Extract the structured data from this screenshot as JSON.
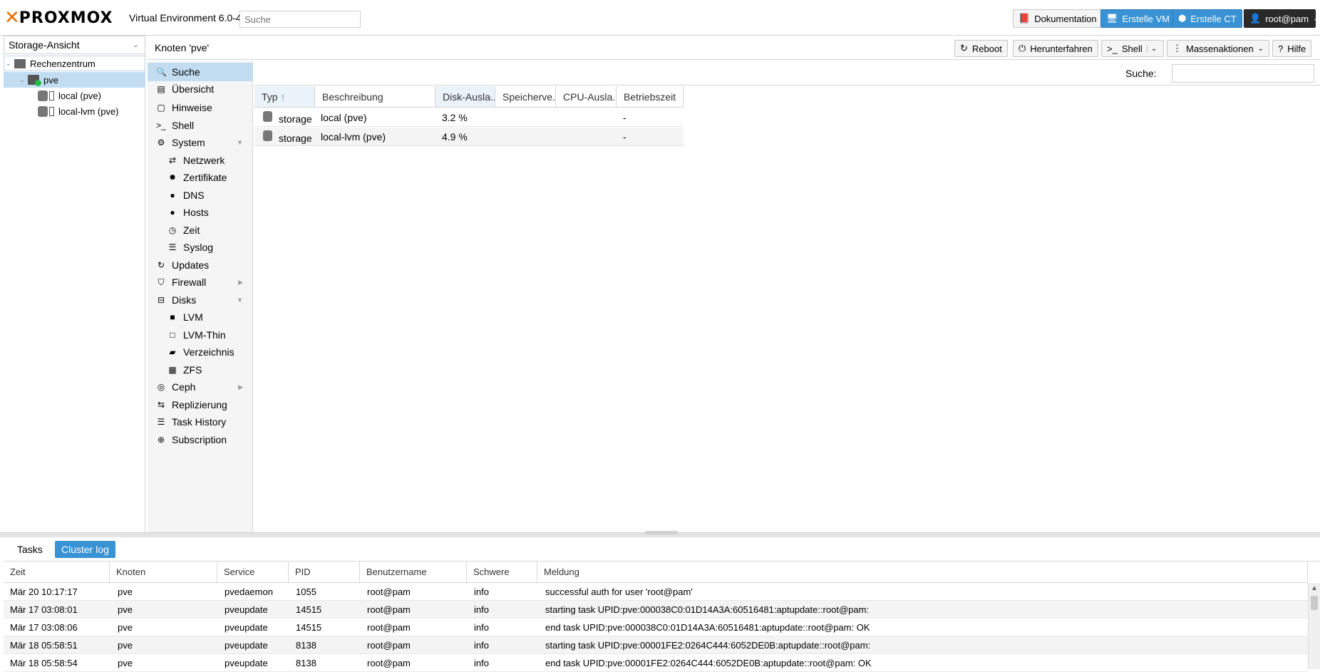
{
  "header": {
    "logo_text": "PROXMOX",
    "version": "Virtual Environment 6.0-4",
    "search_placeholder": "Suche",
    "buttons": {
      "docs": "Dokumentation",
      "create_vm": "Erstelle VM",
      "create_ct": "Erstelle CT",
      "user": "root@pam"
    }
  },
  "tree": {
    "view_selector": "Storage-Ansicht",
    "items": {
      "datacenter": "Rechenzentrum",
      "node": "pve",
      "storage_local": "local (pve)",
      "storage_lvm": "local-lvm (pve)"
    }
  },
  "node_panel": {
    "title": "Knoten 'pve'",
    "toolbar": {
      "reboot": "Reboot",
      "shutdown": "Herunterfahren",
      "shell": "Shell",
      "bulk": "Massenaktionen",
      "help": "Hilfe"
    }
  },
  "menu": {
    "search": "Suche",
    "overview": "Übersicht",
    "notes": "Hinweise",
    "shell": "Shell",
    "system": "System",
    "network": "Netzwerk",
    "certificates": "Zertifikate",
    "dns": "DNS",
    "hosts": "Hosts",
    "time": "Zeit",
    "syslog": "Syslog",
    "updates": "Updates",
    "firewall": "Firewall",
    "disks": "Disks",
    "lvm": "LVM",
    "lvm_thin": "LVM-Thin",
    "directory": "Verzeichnis",
    "zfs": "ZFS",
    "ceph": "Ceph",
    "replication": "Replizierung",
    "task_history": "Task History",
    "subscription": "Subscription"
  },
  "search_panel": {
    "search_label": "Suche:",
    "columns": [
      "Typ",
      "Beschreibung",
      "Disk-Ausla...",
      "Speicherve...",
      "CPU-Ausla...",
      "Betriebszeit"
    ],
    "rows": [
      {
        "type": "storage",
        "description": "local (pve)",
        "disk": "3.2 %",
        "mem": "",
        "cpu": "",
        "uptime": "-"
      },
      {
        "type": "storage",
        "description": "local-lvm (pve)",
        "disk": "4.9 %",
        "mem": "",
        "cpu": "",
        "uptime": "-"
      }
    ]
  },
  "bottom": {
    "tabs": [
      "Tasks",
      "Cluster log"
    ],
    "columns": [
      "Zeit",
      "Knoten",
      "Service",
      "PID",
      "Benutzername",
      "Schwere",
      "Meldung"
    ],
    "rows": [
      {
        "time": "Mär 20 10:17:17",
        "node": "pve",
        "service": "pvedaemon",
        "pid": "1055",
        "user": "root@pam",
        "severity": "info",
        "message": "successful auth for user 'root@pam'"
      },
      {
        "time": "Mär 17 03:08:01",
        "node": "pve",
        "service": "pveupdate",
        "pid": "14515",
        "user": "root@pam",
        "severity": "info",
        "message": "starting task UPID:pve:000038C0:01D14A3A:60516481:aptupdate::root@pam:"
      },
      {
        "time": "Mär 17 03:08:06",
        "node": "pve",
        "service": "pveupdate",
        "pid": "14515",
        "user": "root@pam",
        "severity": "info",
        "message": "end task UPID:pve:000038C0:01D14A3A:60516481:aptupdate::root@pam: OK"
      },
      {
        "time": "Mär 18 05:58:51",
        "node": "pve",
        "service": "pveupdate",
        "pid": "8138",
        "user": "root@pam",
        "severity": "info",
        "message": "starting task UPID:pve:00001FE2:0264C444:6052DE0B:aptupdate::root@pam:"
      },
      {
        "time": "Mär 18 05:58:54",
        "node": "pve",
        "service": "pveupdate",
        "pid": "8138",
        "user": "root@pam",
        "severity": "info",
        "message": "end task UPID:pve:00001FE2:0264C444:6052DE0B:aptupdate::root@pam: OK"
      }
    ]
  },
  "colors": {
    "accent": "#3892d4",
    "brand_orange": "#e57000",
    "selection": "#c2ddf2"
  }
}
